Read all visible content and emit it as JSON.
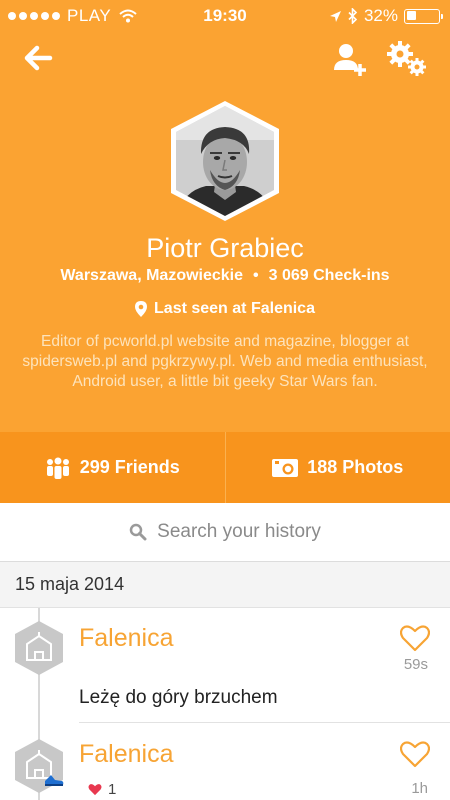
{
  "status_bar": {
    "carrier": "PLAY",
    "time": "19:30",
    "battery": "32%",
    "battery_level": 0.32
  },
  "nav": {
    "back_icon": "back-arrow-icon",
    "add_friend_icon": "add-friend-icon",
    "settings_icon": "gears-icon"
  },
  "profile": {
    "name": "Piotr Grabiec",
    "location": "Warszawa, Mazowieckie",
    "separator": "•",
    "checkins": "3 069 Check-ins",
    "last_seen": "Last seen at Falenica",
    "bio": "Editor of pcworld.pl website and magazine, blogger at spidersweb.pl and pgkrzywy.pl. Web and media enthusiast, Android user, a little bit geeky Star Wars fan."
  },
  "stats": {
    "friends": "299 Friends",
    "photos": "188 Photos"
  },
  "search": {
    "placeholder": "Search your history"
  },
  "history": {
    "date": "15 maja 2014",
    "checkins": [
      {
        "venue": "Falenica",
        "time_ago": "59s",
        "shout": "Leżę do góry brzuchem"
      },
      {
        "venue": "Falenica",
        "time_ago": "1h",
        "likes": "1"
      }
    ]
  },
  "colors": {
    "accent": "#fba332",
    "stats_bg": "#f8941d",
    "venue_text": "#f7a434",
    "like_heart": "#e8384f"
  }
}
